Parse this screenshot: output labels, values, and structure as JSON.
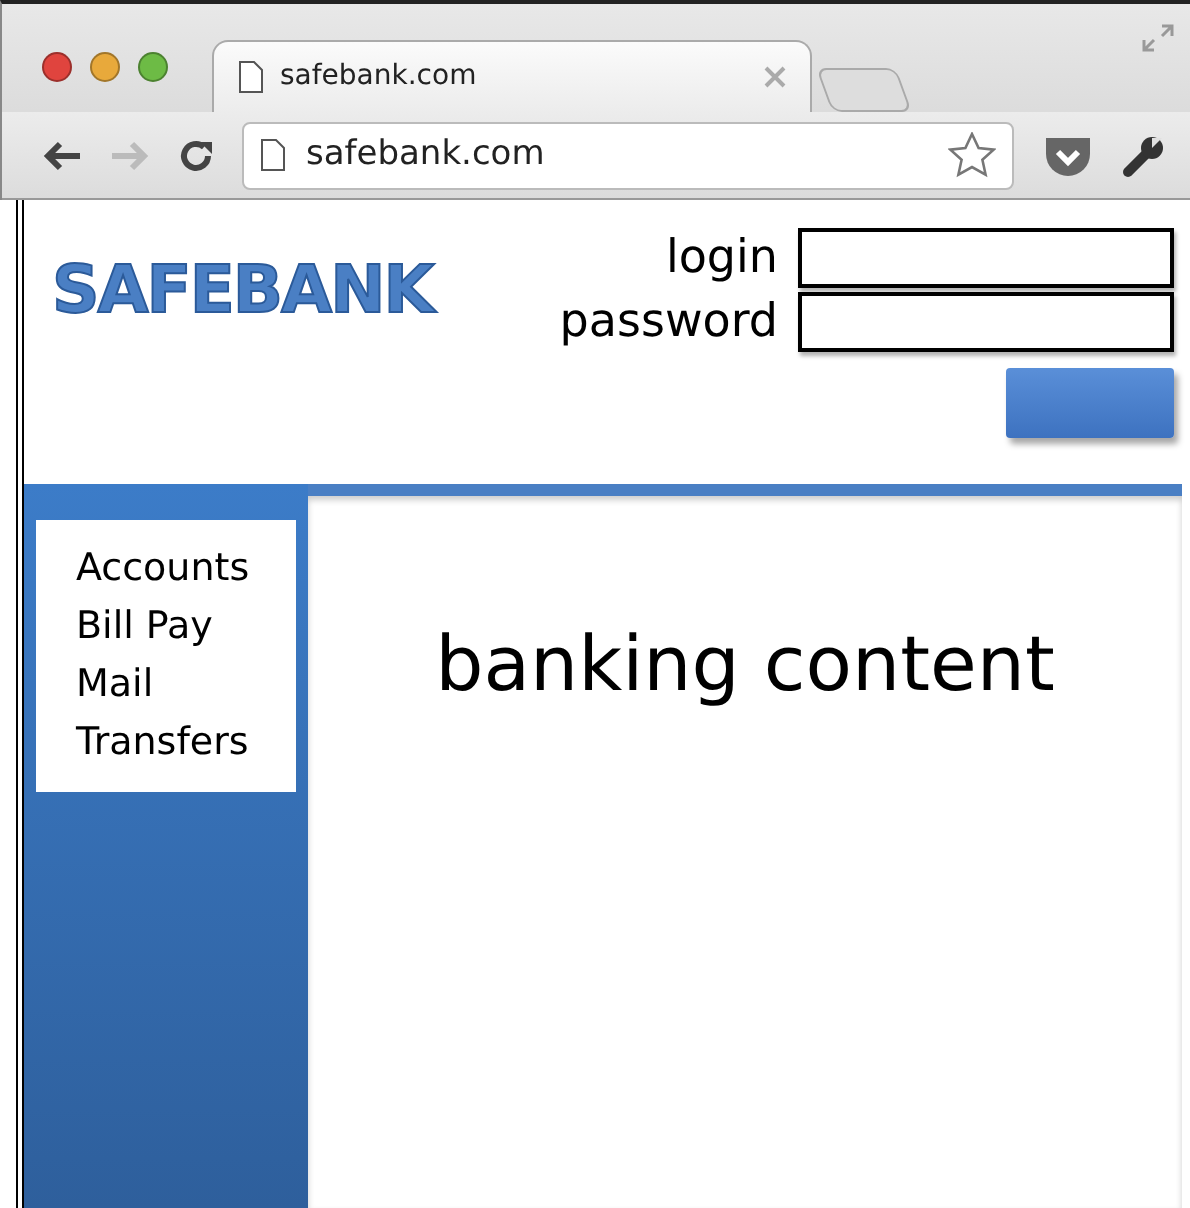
{
  "browser": {
    "tab_title": "safebank.com",
    "address": "safebank.com"
  },
  "header": {
    "logo": "SAFEBANK",
    "fields": [
      {
        "label": "login"
      },
      {
        "label": "password"
      }
    ]
  },
  "sidebar": {
    "items": [
      {
        "label": "Accounts"
      },
      {
        "label": "Bill Pay"
      },
      {
        "label": "Mail"
      },
      {
        "label": "Transfers"
      }
    ]
  },
  "content": {
    "text": "banking content"
  }
}
